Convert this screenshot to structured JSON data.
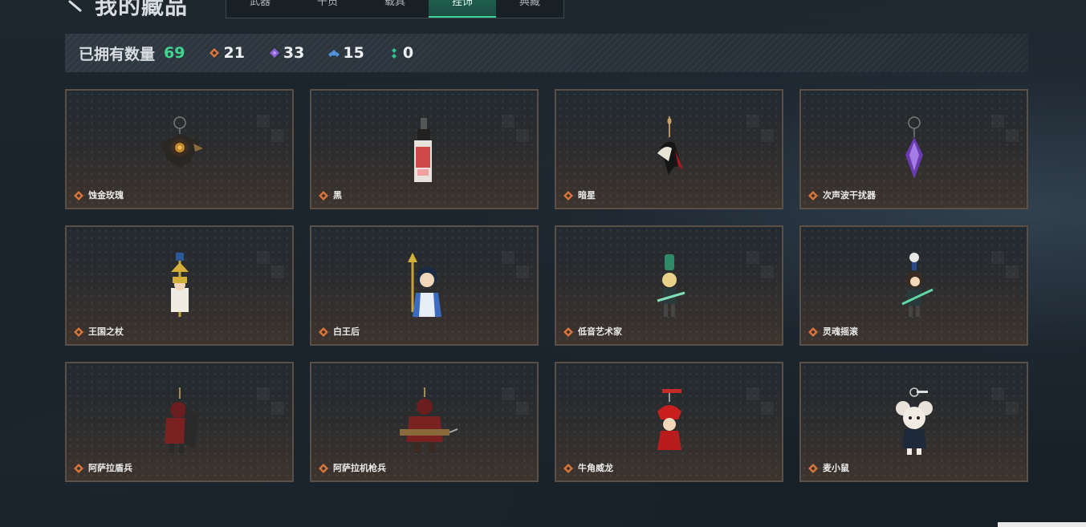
{
  "header": {
    "title": "我的藏品",
    "tabs": [
      {
        "label": "武器",
        "active": false
      },
      {
        "label": "干员",
        "active": false
      },
      {
        "label": "载具",
        "active": false
      },
      {
        "label": "挂饰",
        "active": true
      },
      {
        "label": "典藏",
        "active": false
      }
    ]
  },
  "stats": {
    "owned_label": "已拥有数量",
    "owned_count": "69",
    "rarities": [
      {
        "icon": "orange-diamond-icon",
        "color": "#d8743a",
        "count": "21"
      },
      {
        "icon": "purple-diamond-icon",
        "color": "#8a5fd6",
        "count": "33"
      },
      {
        "icon": "blue-diamond-icon",
        "color": "#4f92d8",
        "count": "15"
      },
      {
        "icon": "green-dots-icon",
        "color": "#30c48f",
        "count": "0"
      }
    ]
  },
  "items": [
    {
      "name": "蚀金玫瑰",
      "rarity_color": "#d8743a",
      "icon": "golden-rose-charm-icon"
    },
    {
      "name": "黑",
      "rarity_color": "#d8743a",
      "icon": "black-device-charm-icon"
    },
    {
      "name": "暗星",
      "rarity_color": "#d8743a",
      "icon": "dark-star-charm-icon"
    },
    {
      "name": "次声波干扰器",
      "rarity_color": "#d8743a",
      "icon": "purple-crystal-charm-icon"
    },
    {
      "name": "王国之杖",
      "rarity_color": "#d8743a",
      "icon": "kingdom-scepter-charm-icon"
    },
    {
      "name": "白王后",
      "rarity_color": "#d8743a",
      "icon": "white-queen-charm-icon"
    },
    {
      "name": "低音艺术家",
      "rarity_color": "#d8743a",
      "icon": "bass-artist-charm-icon"
    },
    {
      "name": "灵魂摇滚",
      "rarity_color": "#d8743a",
      "icon": "soul-rock-charm-icon"
    },
    {
      "name": "阿萨拉盾兵",
      "rarity_color": "#d8743a",
      "icon": "shield-soldier-charm-icon"
    },
    {
      "name": "阿萨拉机枪兵",
      "rarity_color": "#d8743a",
      "icon": "machine-gunner-charm-icon"
    },
    {
      "name": "牛角威龙",
      "rarity_color": "#d8743a",
      "icon": "horned-dragon-charm-icon"
    },
    {
      "name": "麦小鼠",
      "rarity_color": "#d8743a",
      "icon": "little-mouse-charm-icon"
    }
  ]
}
